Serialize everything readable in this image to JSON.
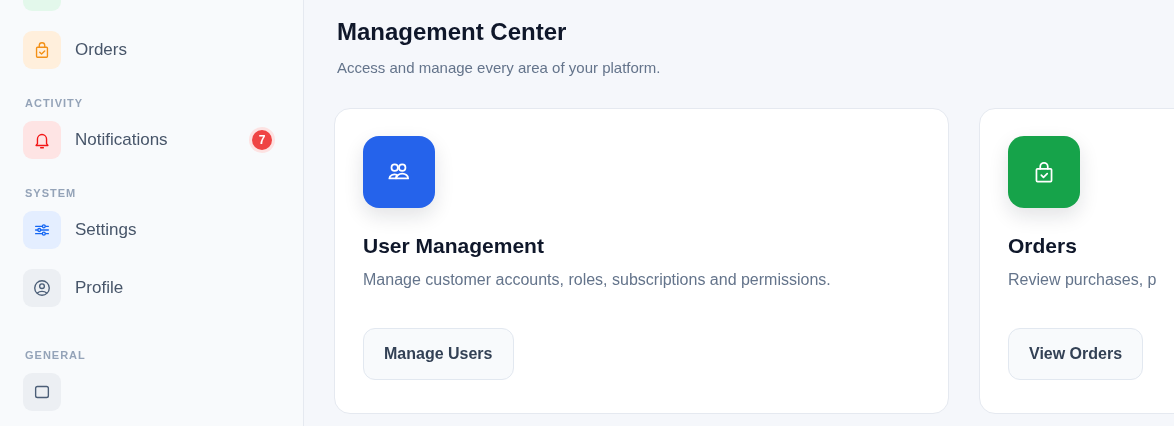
{
  "sidebar": {
    "sections": [
      {
        "items": [
          {
            "color": "#e3f8eb"
          },
          {
            "label": "Orders",
            "color": "#ffefdc"
          }
        ]
      },
      {
        "title": "ACTIVITY",
        "items": [
          {
            "label": "Notifications",
            "color": "#fee4e4",
            "badge": "7"
          }
        ]
      },
      {
        "title": "SYSTEM",
        "items": [
          {
            "label": "Settings",
            "color": "#e4eeff"
          },
          {
            "label": "Profile",
            "color": "#eceff3"
          }
        ]
      },
      {
        "title": "GENERAL",
        "items": [
          {
            "color": "#eceff3"
          }
        ]
      }
    ]
  },
  "main": {
    "title": "Management Center",
    "subtitle": "Access and manage every area of your platform.",
    "cards": [
      {
        "title": "User Management",
        "description": "Manage customer accounts, roles, subscriptions and permissions.",
        "button": "Manage Users",
        "color": "#2563eb"
      },
      {
        "title": "Orders",
        "description": "Review purchases, p",
        "button": "View Orders",
        "color": "#16a34a"
      }
    ]
  }
}
